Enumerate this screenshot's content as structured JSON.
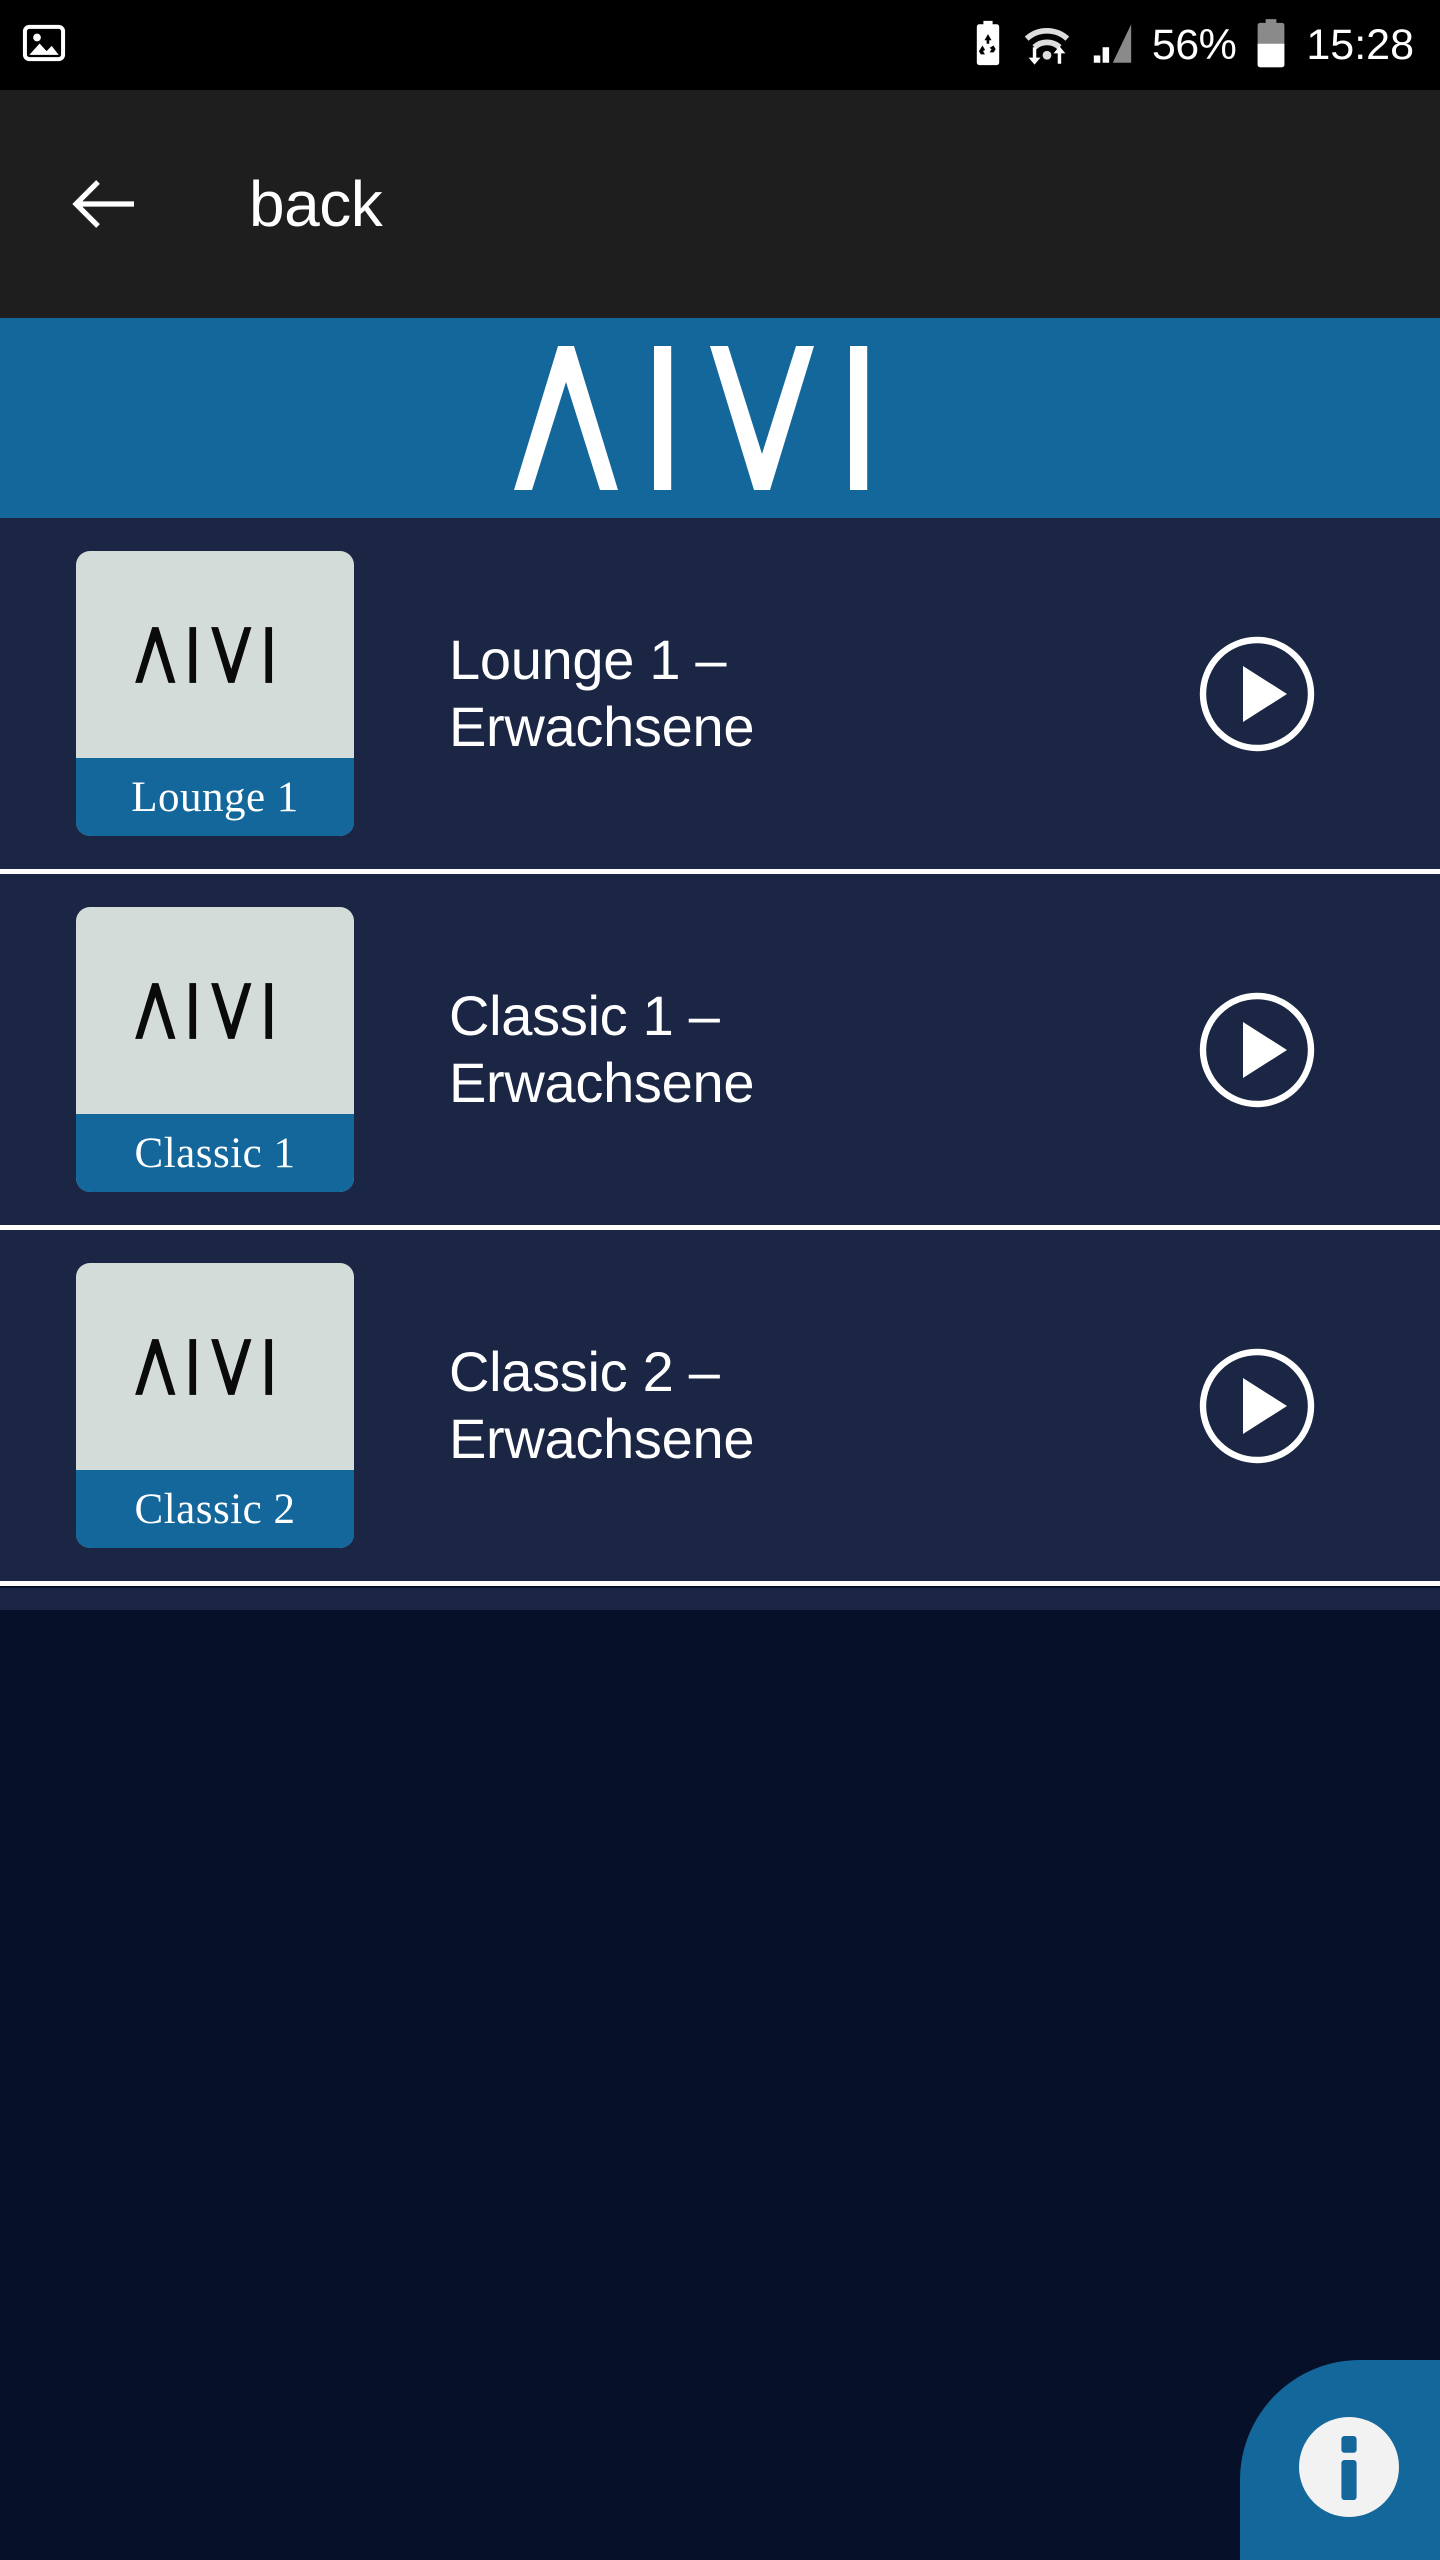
{
  "statusbar": {
    "left_icons": [
      {
        "name": "screenshot-image-icon",
        "glyph": "image"
      }
    ],
    "right_icons": [
      {
        "name": "battery-recycle-icon",
        "glyph": "recycle-battery"
      },
      {
        "name": "wifi-transfer-icon",
        "glyph": "wifi"
      },
      {
        "name": "cellular-signal-icon",
        "glyph": "signal"
      }
    ],
    "battery_percent": "56%",
    "battery_icon": "battery-icon",
    "clock": "15:28"
  },
  "appbar": {
    "back_icon": "arrow-left-icon",
    "title": "back"
  },
  "banner": {
    "logo_text": "AIVI",
    "background_color": "#13679b",
    "logo_color": "#ffffff"
  },
  "colors": {
    "accent_blue": "#13679b",
    "row_navy": "#1a2643",
    "page_navy": "#061029",
    "thumb_bg": "#d3dcd9",
    "divider": "#ffffff",
    "statusbar_bg": "#000000",
    "appbar_bg": "#1e1e1e"
  },
  "list": {
    "items": [
      {
        "thumb_logo": "AIVI",
        "thumb_label": "Lounge 1",
        "title": "Lounge 1 –\nErwachsene",
        "play_icon": "play-circle-icon"
      },
      {
        "thumb_logo": "AIVI",
        "thumb_label": "Classic 1",
        "title": "Classic 1 –\nErwachsene",
        "play_icon": "play-circle-icon"
      },
      {
        "thumb_logo": "AIVI",
        "thumb_label": "Classic 2",
        "title": "Classic 2 –\nErwachsene",
        "play_icon": "play-circle-icon"
      }
    ]
  },
  "fab": {
    "icon": "info-icon",
    "background_color": "#13679b"
  }
}
